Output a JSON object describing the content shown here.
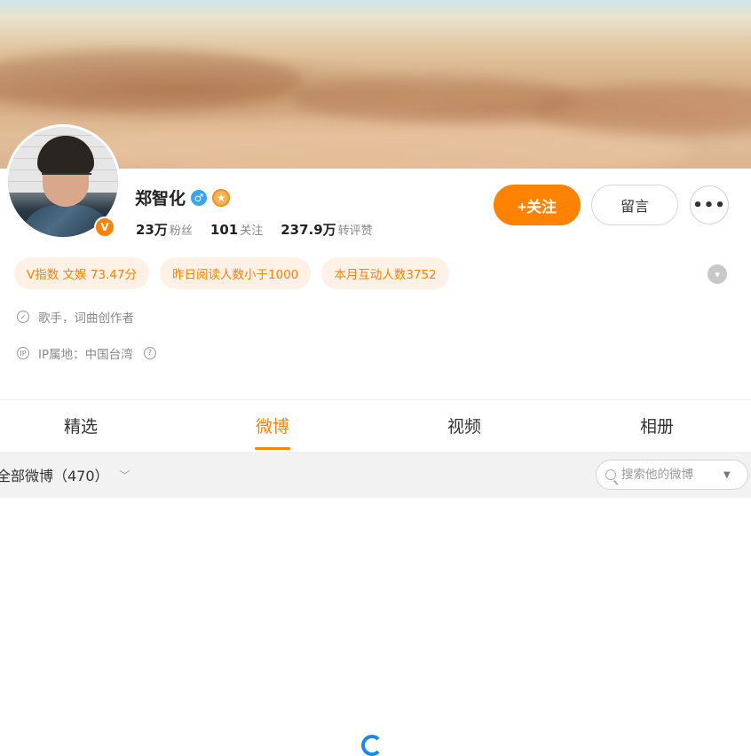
{
  "profile": {
    "name": "郑智化",
    "gender_icon": "male-gender-icon",
    "medal_icon": "fan-medal-icon",
    "verified_icon": "orange-verified-badge-icon",
    "stats": [
      {
        "value": "23万",
        "label": "粉丝"
      },
      {
        "value": "101",
        "label": "关注"
      },
      {
        "value": "237.9万",
        "label": "转评赞"
      }
    ]
  },
  "actions": {
    "follow_label": "+关注",
    "message_label": "留言",
    "more_label": "•••"
  },
  "tags": [
    "V指数 文娱 73.47分",
    "昨日阅读人数小于1000",
    "本月互动人数3752"
  ],
  "info": {
    "profession": "歌手，词曲创作者",
    "ip_location": "IP属地：中国台湾"
  },
  "tabs": [
    "精选",
    "微博",
    "视频",
    "相册"
  ],
  "active_tab": "微博",
  "filter": {
    "label": "全部微博（470）"
  },
  "search": {
    "placeholder": "搜索他的微博"
  },
  "colors": {
    "accent": "#ff8200",
    "tag_bg": "#fff1e6",
    "filter_bar_bg": "#f2f2f2",
    "spinner": "#1e88e5"
  }
}
